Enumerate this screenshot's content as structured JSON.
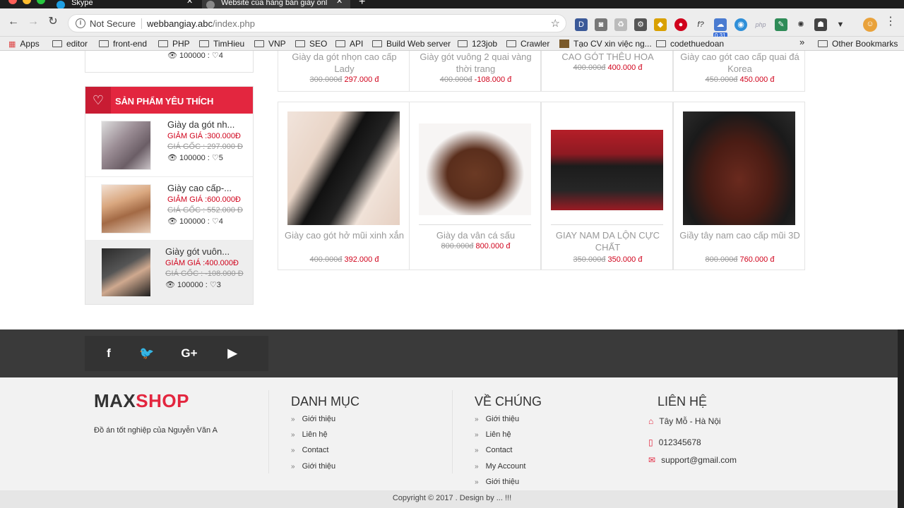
{
  "browser": {
    "tabs": [
      {
        "label": "Skype"
      },
      {
        "label": "Website của hàng bán giày onl"
      }
    ],
    "omnibox": {
      "security": "Not Secure",
      "host": "webbangiay.abc",
      "path": "/index.php"
    },
    "bookmarks": [
      {
        "label": "Apps"
      },
      {
        "label": "editor"
      },
      {
        "label": "front-end"
      },
      {
        "label": "PHP"
      },
      {
        "label": "TimHieu"
      },
      {
        "label": "VNP"
      },
      {
        "label": "SEO"
      },
      {
        "label": "API"
      },
      {
        "label": "Build Web server"
      },
      {
        "label": "123job"
      },
      {
        "label": "Crawler"
      },
      {
        "label": "Tạo CV xin việc ng..."
      },
      {
        "label": "codethuedoan"
      }
    ],
    "overflow": "»",
    "other_bookmarks": "Other Bookmarks",
    "extension_badge": "0.31"
  },
  "top_sidebar_stats": "100000 : ♡4",
  "top_products": [
    {
      "name": "Giày da gót nhọn cao cấp Lady",
      "old": "300.000đ",
      "new": "297.000 đ"
    },
    {
      "name": "Giày gót vuông 2 quai vàng thời trang",
      "old": "400.000đ",
      "new": "-108.000 đ"
    },
    {
      "name": "CAO GÓT THÊU HOA",
      "old": "400.000đ",
      "new": "400.000 đ"
    },
    {
      "name": "Giày cao gót cao cấp quai đá Korea",
      "old": "450.000đ",
      "new": "450.000 đ"
    }
  ],
  "favorites": {
    "title": "SẢN PHẨM YÊU THÍCH",
    "items": [
      {
        "name": "Giày da gót nh...",
        "sale": "GIẢM GIÁ :300.000Đ",
        "orig": "GIÁ GỐC : 297.000 Đ",
        "views": "100000 :",
        "likes": "5"
      },
      {
        "name": "Giày cao cấp-...",
        "sale": "GIẢM GIÁ :600.000Đ",
        "orig": "GIÁ GỐC : 552.000 Đ",
        "views": "100000 :",
        "likes": "4"
      },
      {
        "name": "Giày gót vuôn...",
        "sale": "GIẢM GIÁ :400.000Đ",
        "orig": "GIÁ GỐC : -108.000 Đ",
        "views": "100000 :",
        "likes": "3"
      }
    ]
  },
  "products": [
    {
      "name": "Giày cao gót hở mũi xinh xắn",
      "old": "400.000đ",
      "new": "392.000 đ"
    },
    {
      "name": "Giày da vân cá sấu",
      "old": "800.000đ",
      "new": "800.000 đ"
    },
    {
      "name": "GIAY NAM DA LỘN CỰC CHẤT",
      "old": "350.000đ",
      "new": "350.000 đ"
    },
    {
      "name": "Giầy tây nam cao cấp mũi 3D",
      "old": "800.000đ",
      "new": "760.000 đ"
    }
  ],
  "social": {
    "facebook": "f",
    "google": "G+"
  },
  "footer": {
    "logo_max": "MAX",
    "logo_shop": "SHOP",
    "tagline": "Đồ án tốt nghiệp của Nguyễn Văn A",
    "danh_muc": {
      "title": "DANH MỤC",
      "links": [
        "Giới thiệu",
        "Liên hệ",
        "Contact",
        "Giới thiệu"
      ]
    },
    "ve_chung": {
      "title": "VỀ CHÚNG",
      "links": [
        "Giới thiệu",
        "Liên hệ",
        "Contact",
        "My Account",
        "Giới thiệu"
      ]
    },
    "lien_he": {
      "title": "LIÊN HỆ",
      "address": "Tây Mỗ - Hà Nội",
      "phone": "012345678",
      "email": "support@gmail.com"
    },
    "copyright": "Copyright © 2017 . Design by ... !!!"
  },
  "colors": {
    "accent": "#e3263f",
    "price": "#d0021b",
    "footer_dark": "#3a3a3a"
  }
}
